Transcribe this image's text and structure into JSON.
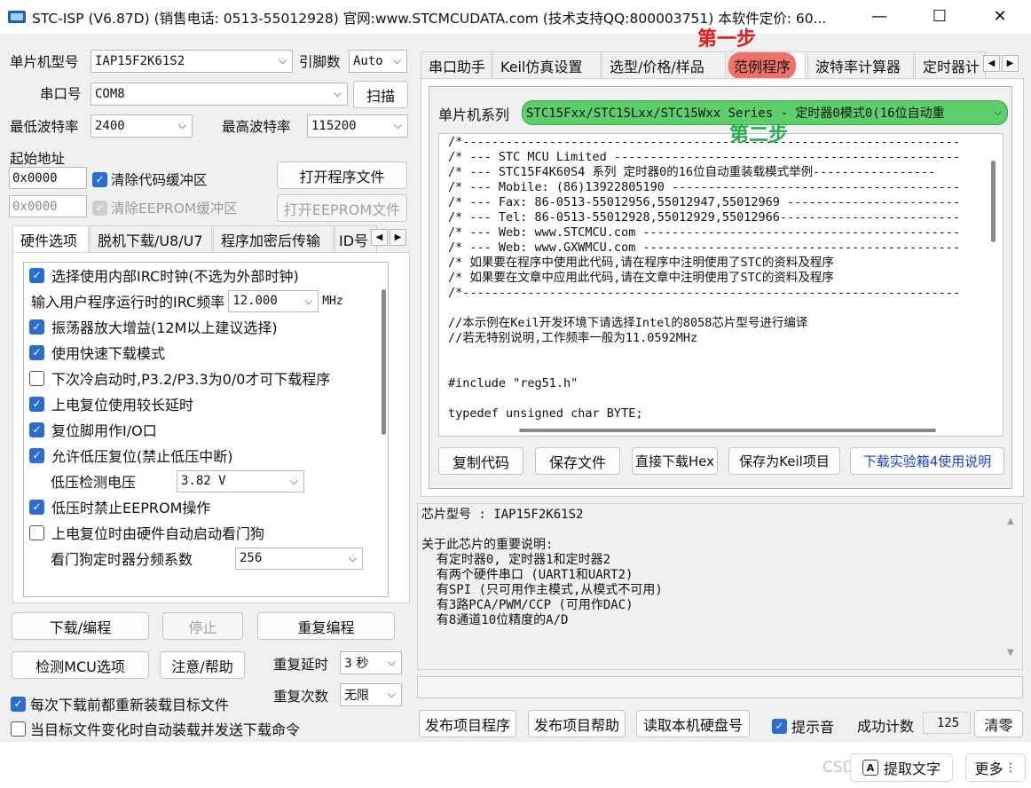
{
  "window": {
    "title": "STC-ISP (V6.87D) (销售电话: 0513-55012928) 官网:www.STCMCUDATA.com  (技术支持QQ:800003751) 本软件定价: 60...",
    "minimize_glyph": "—",
    "maximize_glyph": "☐",
    "close_glyph": "✕"
  },
  "left": {
    "mcu_type_label": "单片机型号",
    "mcu_type_value": "IAP15F2K61S2",
    "pins_label": "引脚数",
    "pins_value": "Auto",
    "port_label": "串口号",
    "port_value": "COM8",
    "scan_button": "扫描",
    "min_baud_label": "最低波特率",
    "min_baud_value": "2400",
    "max_baud_label": "最高波特率",
    "max_baud_value": "115200",
    "start_addr_label": "起始地址",
    "addr1_value": "0x0000",
    "clear_code_label": "清除代码缓冲区",
    "open_program_button": "打开程序文件",
    "addr2_value": "0x0000",
    "clear_eeprom_label": "清除EEPROM缓冲区",
    "open_eeprom_button": "打开EEPROM文件",
    "tabs": [
      "硬件选项",
      "脱机下载/U8/U7",
      "程序加密后传输",
      "ID号"
    ],
    "options": {
      "internal_irc": "选择使用内部IRC时钟(不选为外部时钟)",
      "irc_freq_label": "输入用户程序运行时的IRC频率",
      "irc_freq_value": "12.000",
      "irc_freq_unit": "MHz",
      "osc_gain": "振荡器放大增益(12M以上建议选择)",
      "fast_download": "使用快速下载模式",
      "cold_start": "下次冷启动时,P3.2/P3.3为0/0才可下载程序",
      "power_on_delay": "上电复位使用较长延时",
      "reset_pin_io": "复位脚用作I/O口",
      "low_voltage_reset": "允许低压复位(禁止低压中断)",
      "lv_detect_label": "低压检测电压",
      "lv_detect_value": "3.82 V",
      "lv_disable_eeprom": "低压时禁止EEPROM操作",
      "watchdog_auto": "上电复位时由硬件自动启动看门狗",
      "watchdog_div_label": "看门狗定时器分频系数",
      "watchdog_div_value": "256"
    },
    "download_button": "下载/编程",
    "stop_button": "停止",
    "reprogram_button": "重复编程",
    "check_mcu_button": "检测MCU选项",
    "help_button": "注意/帮助",
    "repeat_delay_label": "重复延时",
    "repeat_delay_value": "3 秒",
    "repeat_count_label": "重复次数",
    "repeat_count_value": "无限",
    "reload_label": "每次下载前都重新装载目标文件",
    "auto_send_label": "当目标文件变化时自动装载并发送下载命令"
  },
  "right": {
    "tabs": [
      "串口助手",
      "Keil仿真设置",
      "选型/价格/样品",
      "范例程序",
      "波特率计算器",
      "定时器计"
    ],
    "series_label": "单片机系列",
    "series_value": "STC15Fxx/STC15Lxx/STC15Wxx Series - 定时器0模式0(16位自动重",
    "code_lines": [
      "/*---------------------------------------------------------------------",
      "/* --- STC MCU Limited ------------------------------------------------",
      "/* --- STC15F4K60S4 系列 定时器0的16位自动重装载模式举例-----------------",
      "/* --- Mobile: (86)13922805190 ----------------------------------------",
      "/* --- Fax: 86-0513-55012956,55012947,55012969 ------------------------",
      "/* --- Tel: 86-0513-55012928,55012929,55012966-------------------------",
      "/* --- Web: www.STCMCU.com --------------------------------------------",
      "/* --- Web: www.GXWMCU.com --------------------------------------------",
      "/* 如果要在程序中使用此代码,请在程序中注明使用了STC的资料及程序",
      "/* 如果要在文章中应用此代码,请在文章中注明使用了STC的资料及程序",
      "/*---------------------------------------------------------------------",
      "",
      "//本示例在Keil开发环境下请选择Intel的8058芯片型号进行编译",
      "//若无特别说明,工作频率一般为11.0592MHz",
      "",
      "",
      "#include \"reg51.h\"",
      "",
      "typedef unsigned char BYTE;"
    ],
    "copy_code_button": "复制代码",
    "save_file_button": "保存文件",
    "direct_download_button": "直接下载Hex",
    "save_keil_button": "保存为Keil项目",
    "kit_link": "下载实验箱4使用说明",
    "info_lines": [
      "芯片型号 : IAP15F2K61S2",
      "",
      "关于此芯片的重要说明:",
      "  有定时器0, 定时器1和定时器2",
      "  有两个硬件串口 (UART1和UART2)",
      "  有SPI (只可用作主模式,从模式不可用)",
      "  有3路PCA/PWM/CCP (可用作DAC)",
      "  有8通道10位精度的A/D"
    ],
    "publish_program_button": "发布项目程序",
    "publish_help_button": "发布项目帮助",
    "read_disk_button": "读取本机硬盘号",
    "beep_label": "提示音",
    "success_count_label": "成功计数",
    "success_count_value": "125",
    "clear_button": "清零"
  },
  "annotations": {
    "step1": "第一步",
    "step2": "第二步",
    "step1_color": "#e5191c",
    "step2_color": "#22b04b"
  },
  "overlay": {
    "extract_text_button": "提取文字",
    "more_button": "更多",
    "watermark": "CSDN @Xxurg.an"
  },
  "colors": {
    "accent_check": "#2a6dd0",
    "highlight_green": "#5ccf6b",
    "highlight_red": "#f0706a",
    "link_blue": "#1a3fd6"
  }
}
